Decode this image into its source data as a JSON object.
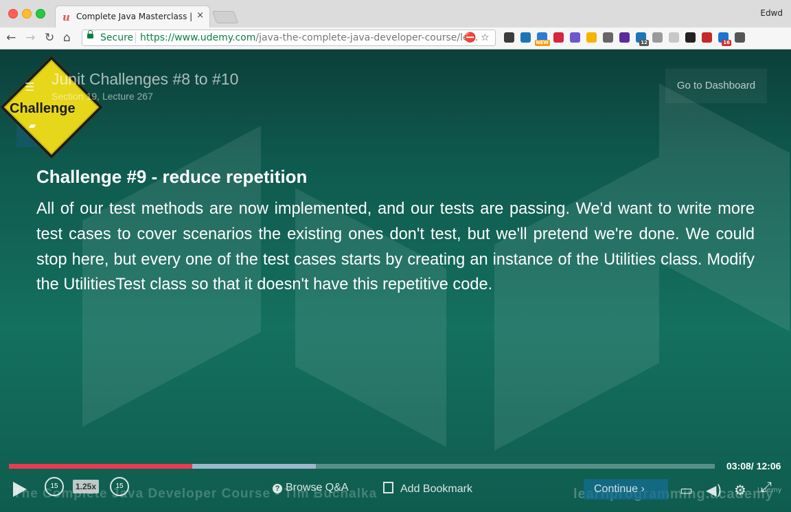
{
  "browser": {
    "tab_title": "Complete Java Masterclass | U",
    "tab_favicon": "u",
    "tab_close": "×",
    "profile_name": "Edwd",
    "secure_label": "Secure",
    "url_host": "https://www.udemy.com",
    "url_path": "/java-the-complete-java-developer-course/le...",
    "extensions": [
      {
        "icon": "evernote-icon",
        "color": "#3b3b3b",
        "badge": ""
      },
      {
        "icon": "s-icon",
        "color": "#1b76b7",
        "badge": ""
      },
      {
        "icon": "new-icon",
        "color": "#2e7bd3",
        "badge": "NEW"
      },
      {
        "icon": "pocket-icon",
        "color": "#d7263d",
        "badge": ""
      },
      {
        "icon": "sync-icon",
        "color": "#6a5acd",
        "badge": ""
      },
      {
        "icon": "google-icon",
        "color": "#f4b400",
        "badge": ""
      },
      {
        "icon": "gear-icon",
        "color": "#666666",
        "badge": ""
      },
      {
        "icon": "block-icon",
        "color": "#5b2a9e",
        "badge": ""
      },
      {
        "icon": "s-badge-icon",
        "color": "#1b76b7",
        "badge": "12"
      },
      {
        "icon": "scissors-icon",
        "color": "#9a9a9a",
        "badge": ""
      },
      {
        "icon": "link-icon",
        "color": "#c7c7c7",
        "badge": ""
      },
      {
        "icon": "grid-icon",
        "color": "#222222",
        "badge": ""
      },
      {
        "icon": "t-icon",
        "color": "#c62828",
        "badge": ""
      },
      {
        "icon": "calendar-icon",
        "color": "#1976d2",
        "badge": "16"
      },
      {
        "icon": "menu-icon",
        "color": "#555555",
        "badge": ""
      }
    ]
  },
  "player": {
    "lecture_title": "Junit Challenges #8 to #10",
    "lecture_subtitle": "Section 19, Lecture 267",
    "sign_label": "Challenge",
    "dashboard_button": "Go to Dashboard",
    "challenge_heading": "Challenge #9 - reduce repetition",
    "challenge_body": "All of our test methods are now implemented, and our tests are passing. We'd want to write more test cases to cover scenarios the existing ones don't test, but we'll pretend we're done. We could stop here, but every one of the test cases starts by creating an instance of the Utilities class. Modify the UtilitiesTest class so that it doesn't have this repetitive code.",
    "watermark_left": "The Complete Java Developer Course - Tim Buchalka",
    "watermark_right": "learnprogramming.academy",
    "time_display": "03:08/ 12:06",
    "progress_played_fraction": 0.26,
    "progress_buffered_fraction": 0.435,
    "skip_back_label": "15",
    "skip_forward_label": "15",
    "speed_label": "1.25x",
    "browse_qa_label": "Browse Q&A",
    "add_bookmark_label": "Add Bookmark",
    "continue_label": "Continue",
    "udemy_mark": "Udemy",
    "accent_color": "#ec3a4e"
  }
}
